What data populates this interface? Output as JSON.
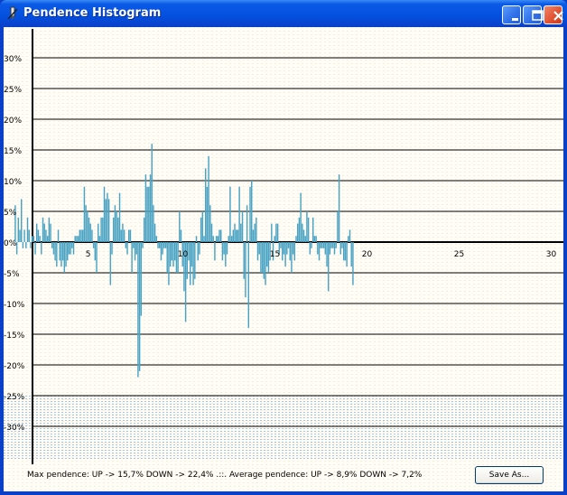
{
  "window": {
    "title": "Pendence Histogram",
    "buttons": {
      "minimize": "minimize-icon",
      "maximize": "maximize-icon",
      "close": "close-icon"
    }
  },
  "status": {
    "text": "Max pendence: UP -> 15,7% DOWN -> 22,4% .::. Average pendence: UP -> 8,9% DOWN -> 7,2%"
  },
  "save_button": {
    "label": "Save As..."
  },
  "colors": {
    "bar": "#4aa3c4",
    "grid": "#000000",
    "background": "#fffdf5",
    "title_bar": "#0350de"
  },
  "chart_data": {
    "type": "bar",
    "title": "",
    "xlabel": "",
    "ylabel": "",
    "ylim": [
      -35,
      35
    ],
    "y_ticks": [
      30,
      25,
      20,
      15,
      10,
      5,
      0,
      -5,
      -10,
      -15,
      -20,
      -25,
      -30
    ],
    "y_tick_labels": [
      "30%",
      "25%",
      "20%",
      "15%",
      "10%",
      "5%",
      "0%",
      "-5%",
      "-10%",
      "-15%",
      "-20%",
      "-25%",
      "-30%"
    ],
    "x_ticks": [
      5,
      10,
      15,
      20,
      25,
      30
    ],
    "x_tick_labels": [
      "5",
      "10",
      "15",
      "20",
      "25",
      "30"
    ],
    "x_range": [
      0.5,
      29.5
    ],
    "grid": true,
    "bars_per_unit": 12,
    "values": [
      6,
      -2,
      4,
      2,
      7,
      -1,
      2,
      -1,
      4,
      2,
      -1,
      1,
      1,
      -2,
      3,
      2,
      1,
      -2,
      4,
      3,
      2,
      1,
      4,
      3,
      -1,
      -2,
      -3,
      -4,
      2,
      -3,
      -4,
      -3,
      -5,
      -4,
      -3,
      -2,
      -2,
      -1,
      -2,
      1,
      1,
      1,
      2,
      2,
      2,
      9,
      6,
      5,
      4,
      3,
      2,
      -1,
      -3,
      -5,
      3,
      1,
      4,
      4,
      9,
      7,
      8,
      7,
      -7,
      -2,
      4,
      6,
      5,
      4,
      8,
      2,
      3,
      2,
      -1,
      -2,
      2,
      2,
      -5,
      -1,
      -3,
      -2,
      -22,
      -21,
      -12,
      -1,
      4,
      11,
      9,
      9,
      11,
      16,
      6,
      3,
      1,
      -1,
      -1,
      -3,
      -2,
      -1,
      -1,
      -5,
      -7,
      -4,
      -3,
      -4,
      -3,
      -5,
      -5,
      5,
      2,
      -4,
      -8,
      -13,
      -6,
      -3,
      -7,
      -4,
      -7,
      -6,
      1,
      -3,
      -2,
      4,
      5,
      1,
      12,
      9,
      14,
      6,
      3,
      1,
      -3,
      1,
      1,
      2,
      2,
      -3,
      -2,
      -4,
      -2,
      1,
      9,
      1,
      2,
      3,
      2,
      2,
      9,
      3,
      5,
      -6,
      -9,
      6,
      -14,
      9,
      10,
      2,
      3,
      4,
      -3,
      -2,
      -5,
      -5,
      -6,
      -7,
      -4,
      -5,
      -3,
      3,
      -3,
      1,
      3,
      3,
      -2,
      -1,
      -3,
      -2,
      -4,
      -2,
      -1,
      -3,
      -5,
      -2,
      -3,
      1,
      3,
      4,
      8,
      3,
      2,
      1,
      5,
      4,
      -2,
      -1,
      4,
      1,
      1,
      -2,
      -3,
      -1,
      -1,
      -1,
      -2,
      -4,
      -8,
      -2,
      -1,
      -1,
      -2,
      -1,
      5,
      11,
      -2,
      -1,
      -3,
      -3,
      -4,
      1,
      2,
      -4,
      -7
    ]
  }
}
